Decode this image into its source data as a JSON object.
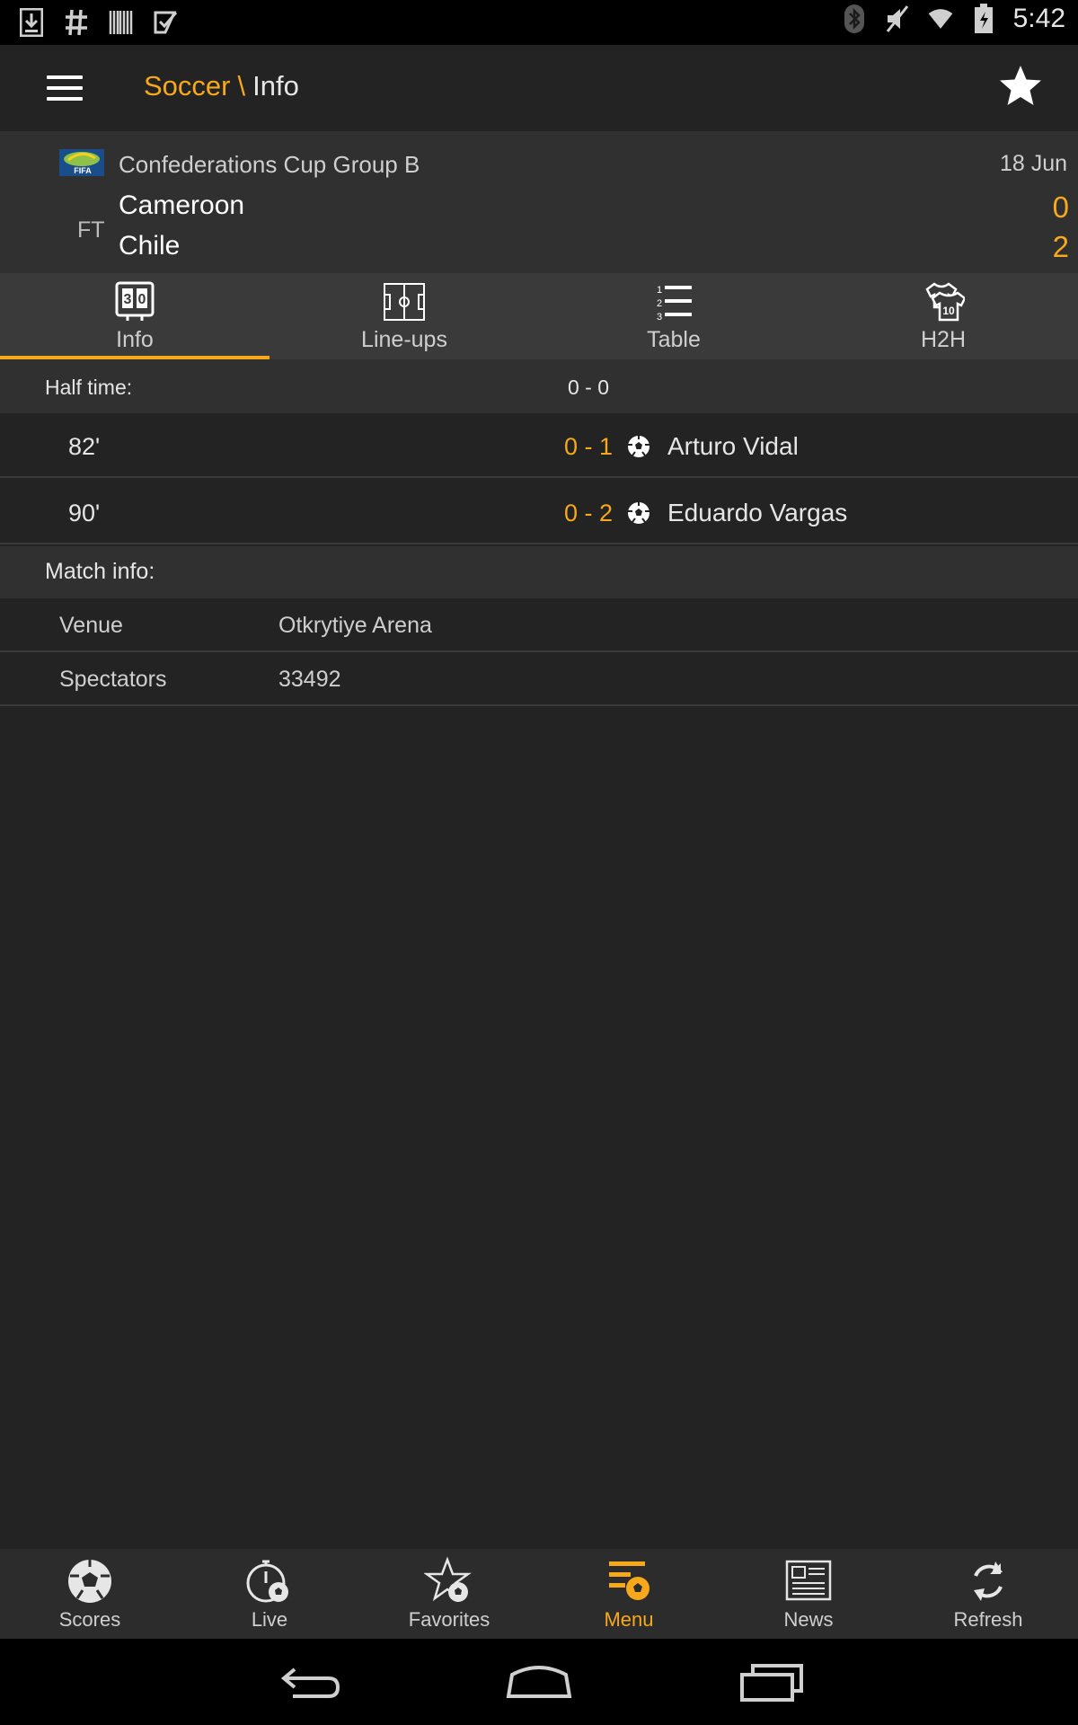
{
  "status_bar": {
    "left_icons": [
      "download-icon",
      "hash-icon",
      "barcode-icon",
      "play-store-icon"
    ],
    "right_icons": [
      "bluetooth-icon",
      "mute-icon",
      "wifi-icon",
      "battery-icon"
    ],
    "time": "5:42"
  },
  "app_bar": {
    "section": "Soccer",
    "separator": "\\",
    "page": "Info"
  },
  "match": {
    "competition": "Confederations Cup Group B",
    "date": "18 Jun",
    "status": "FT",
    "home_team": "Cameroon",
    "away_team": "Chile",
    "home_score": "0",
    "away_score": "2"
  },
  "tabs": [
    {
      "label": "Info",
      "icon": "scoreboard-icon",
      "active": true
    },
    {
      "label": "Line-ups",
      "icon": "pitch-icon",
      "active": false
    },
    {
      "label": "Table",
      "icon": "list-icon",
      "active": false
    },
    {
      "label": "H2H",
      "icon": "jersey-icon",
      "active": false
    }
  ],
  "half_time": {
    "label": "Half time:",
    "score": "0 - 0"
  },
  "goals": [
    {
      "minute": "82'",
      "score": "0 - 1",
      "player": "Arturo Vidal"
    },
    {
      "minute": "90'",
      "score": "0 - 2",
      "player": "Eduardo Vargas"
    }
  ],
  "match_info": {
    "title": "Match info:",
    "rows": [
      {
        "key": "Venue",
        "value": "Otkrytiye Arena"
      },
      {
        "key": "Spectators",
        "value": "33492"
      }
    ]
  },
  "bottom_nav": [
    {
      "label": "Scores",
      "icon": "soccer-ball-icon",
      "active": false
    },
    {
      "label": "Live",
      "icon": "stopwatch-icon",
      "active": false
    },
    {
      "label": "Favorites",
      "icon": "star-ball-icon",
      "active": false
    },
    {
      "label": "Menu",
      "icon": "menu-ball-icon",
      "active": true
    },
    {
      "label": "News",
      "icon": "newspaper-icon",
      "active": false
    },
    {
      "label": "Refresh",
      "icon": "refresh-icon",
      "active": false
    }
  ],
  "colors": {
    "accent": "#f7a81b",
    "background": "#232323",
    "header_bg": "#303030",
    "tab_bg": "#3a3a3a"
  }
}
